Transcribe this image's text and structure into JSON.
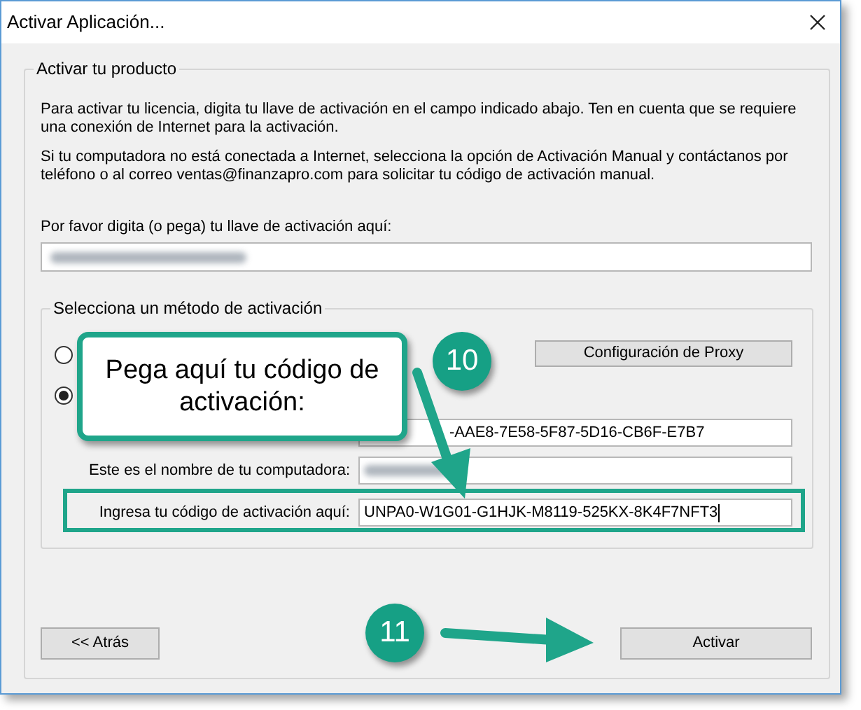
{
  "window": {
    "title": "Activar Aplicación..."
  },
  "product_group": {
    "title": "Activar tu producto",
    "paragraphs": [
      "Para activar tu licencia, digita tu llave de activación en el campo indicado abajo.  Ten en cuenta que se requiere una conexión de Internet para la activación.",
      "Si tu computadora no está conectada a Internet, selecciona la opción de Activación Manual y contáctanos por teléfono o al correo ventas@finanzapro.com para solicitar tu código de activación manual."
    ],
    "key_label": "Por favor digita (o pega) tu llave de activación aquí:"
  },
  "method_group": {
    "title": "Selecciona un método de activación",
    "options": [
      {
        "selected": false
      },
      {
        "selected": true
      }
    ],
    "proxy_button": "Configuración de Proxy",
    "fields": [
      {
        "kind": "license",
        "value": "-AAE8-7E58-5F87-5D16-CB6F-E7B7"
      },
      {
        "kind": "computer",
        "label": "Este es el nombre de tu computadora:"
      },
      {
        "kind": "code",
        "label": "Ingresa tu código de activación aquí:",
        "value": "UNPA0-W1G01-G1HJK-M8119-525KX-8K4F7NFT3",
        "highlighted": true
      }
    ]
  },
  "buttons": [
    {
      "label": "<< Atrás"
    },
    {
      "label": "Activar"
    }
  ],
  "annotations": {
    "callout": "Pega aquí tu código de activación:",
    "steps": [
      "10",
      "11"
    ]
  }
}
